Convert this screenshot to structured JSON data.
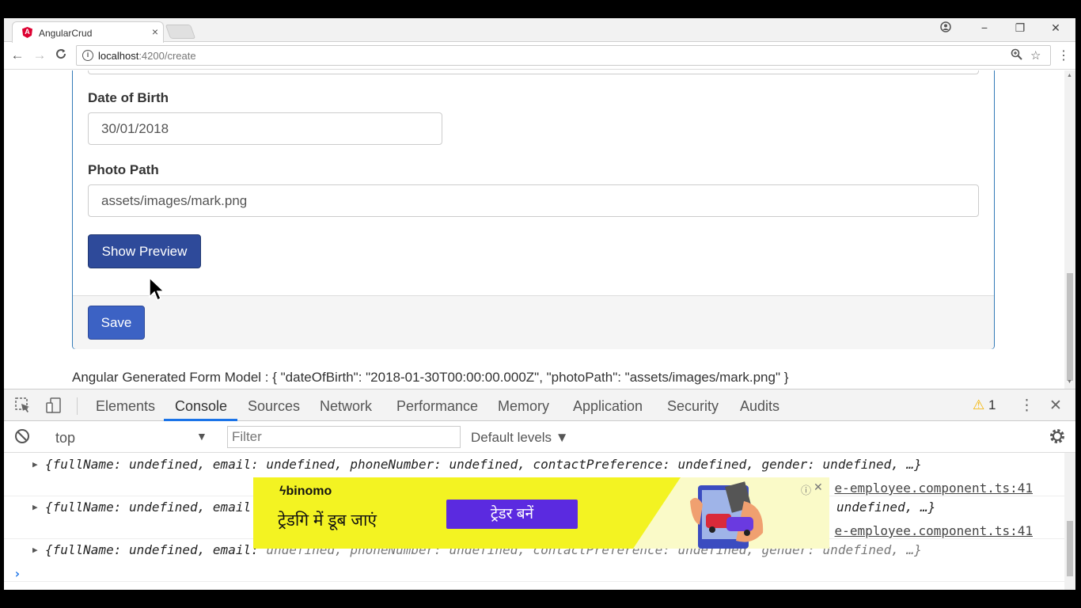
{
  "browser": {
    "tab_title": "AngularCrud",
    "tab_close": "×",
    "favicon_letter": "A",
    "url_host": "localhost",
    "url_path": ":4200/create",
    "window_controls": [
      "−",
      "❐",
      "✕"
    ],
    "nav": {
      "back": "←",
      "forward": "→",
      "reload": "C"
    }
  },
  "form": {
    "dob_label": "Date of Birth",
    "dob_value": "30/01/2018",
    "photo_label": "Photo Path",
    "photo_value": "assets/images/mark.png",
    "preview_button": "Show Preview",
    "save_button": "Save",
    "model_text": "Angular Generated Form Model : { \"dateOfBirth\": \"2018-01-30T00:00:00.000Z\", \"photoPath\": \"assets/images/mark.png\" }"
  },
  "devtools": {
    "tabs": [
      "Elements",
      "Console",
      "Sources",
      "Network",
      "Performance",
      "Memory",
      "Application",
      "Security",
      "Audits"
    ],
    "active_tab": "Console",
    "warning_count": "1",
    "context": "top",
    "filter_placeholder": "Filter",
    "levels_label": "Default levels ▼",
    "log_source": "e-employee.component.ts:41",
    "log_object": "{fullName: undefined, email: undefined, phoneNumber: undefined, contactPreference: undefined, gender: undefined, …}",
    "log_partial": "{fullName: undefined, email",
    "log_tail": "undefined, …}",
    "log_third_prefix": "{fullName: undefined, email:",
    "log_third_rest": " undefined, phoneNumber: undefined, contactPreference: undefined, gender: undefined, …}",
    "prompt": "›"
  },
  "ad": {
    "brand": "binomo",
    "headline": "ट्रेडगि में डूब जाएं",
    "cta": "ट्रेडर बनें",
    "info": "ⓘ",
    "close": "✕"
  },
  "colors": {
    "primary_button": "#2e4a9a",
    "save_button": "#3c62c4",
    "ad_background": "#f3f322",
    "ad_cta": "#5b2ae0",
    "active_tab_underline": "#1a73e8"
  }
}
